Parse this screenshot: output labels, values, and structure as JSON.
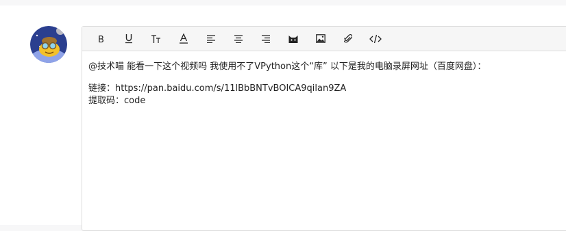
{
  "editor": {
    "toolbar": [
      {
        "name": "bold-button",
        "icon": "bold-icon"
      },
      {
        "name": "underline-button",
        "icon": "underline-icon"
      },
      {
        "name": "text-size-button",
        "icon": "text-size-icon"
      },
      {
        "name": "font-color-button",
        "icon": "font-color-icon"
      },
      {
        "name": "align-left-button",
        "icon": "align-left-icon"
      },
      {
        "name": "align-center-button",
        "icon": "align-center-icon"
      },
      {
        "name": "align-right-button",
        "icon": "align-right-icon"
      },
      {
        "name": "emoji-cat-button",
        "icon": "cat-icon"
      },
      {
        "name": "insert-image-button",
        "icon": "image-icon"
      },
      {
        "name": "attachment-button",
        "icon": "paperclip-icon"
      },
      {
        "name": "code-button",
        "icon": "code-icon"
      }
    ],
    "line1": "@技术喵 能看一下这个视频吗 我使用不了VPython这个“库” 以下是我的电脑录屏网址（百度网盘）：",
    "line2": "链接：https://pan.baidu.com/s/11lBbBNTvBOICA9qilan9ZA",
    "line3": "提取码：code"
  },
  "colors": {
    "border": "#dcdcdc",
    "toolbar_bg": "#f6f6f6",
    "text": "#222222"
  }
}
